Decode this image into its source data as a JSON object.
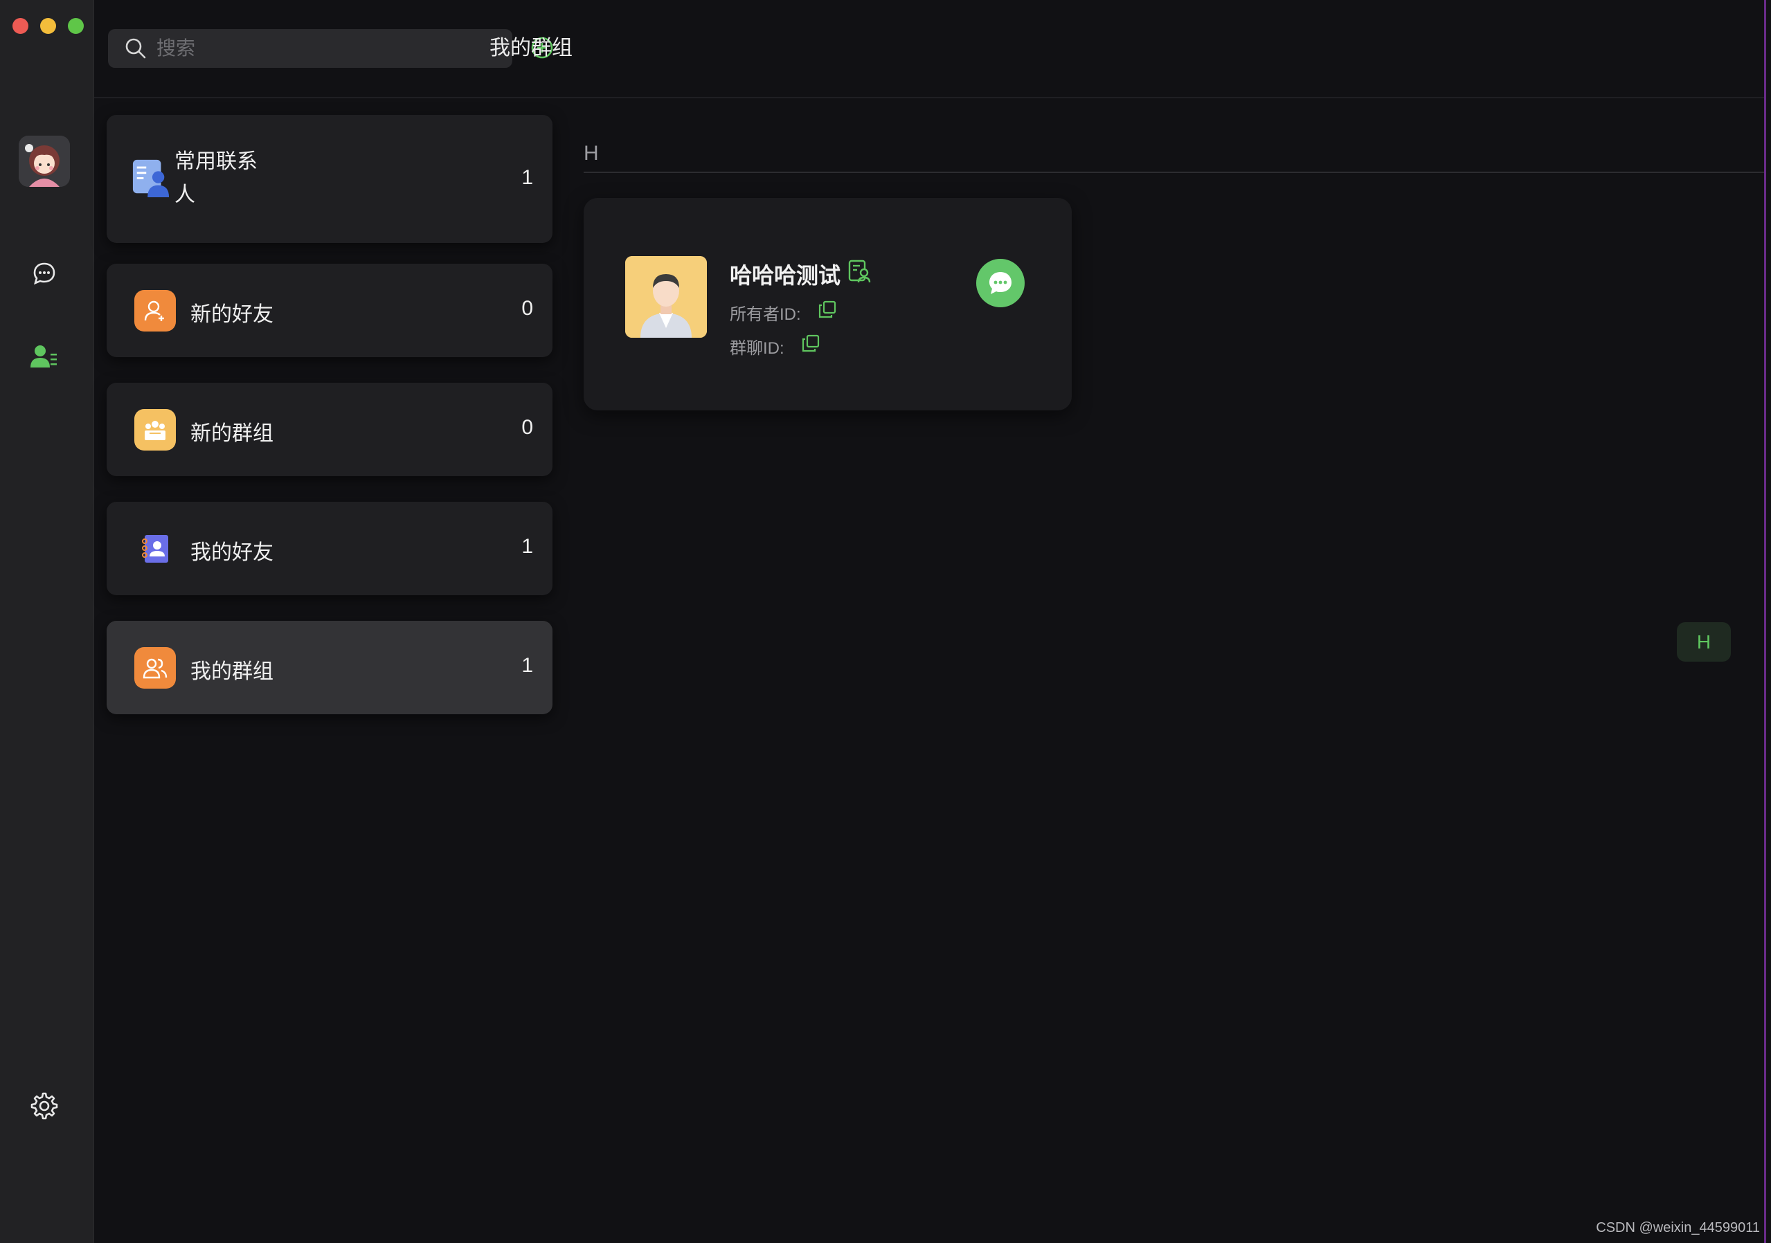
{
  "search": {
    "placeholder": "搜索"
  },
  "header": {
    "title": "我的群组"
  },
  "contacts_menu": [
    {
      "label": "常用联系人",
      "count": "1",
      "icon": "frequent-contacts-icon",
      "color": "#5b84d9"
    },
    {
      "label": "新的好友",
      "count": "0",
      "icon": "new-friend-icon",
      "color": "#f08a3c"
    },
    {
      "label": "新的群组",
      "count": "0",
      "icon": "new-group-icon",
      "color": "#f5c162"
    },
    {
      "label": "我的好友",
      "count": "1",
      "icon": "my-friends-icon",
      "color": "#6a6ee8"
    },
    {
      "label": "我的群组",
      "count": "1",
      "icon": "my-groups-icon",
      "color": "#f08a3c",
      "active": true
    }
  ],
  "groups": {
    "section_letter": "H",
    "items": [
      {
        "name": "哈哈哈测试",
        "owner_label": "所有者ID:",
        "group_id_label": "群聊ID:"
      }
    ]
  },
  "index_letter": "H",
  "watermark": "CSDN @weixin_44599011",
  "colors": {
    "accent": "#63c76a",
    "background": "#111114",
    "rail": "#222224",
    "card": "#1f1f22",
    "card_active": "#333336"
  }
}
